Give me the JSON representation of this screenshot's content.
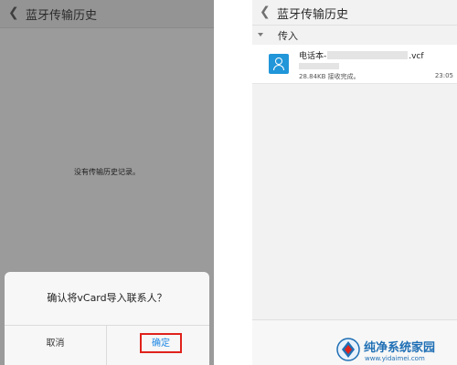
{
  "left_screen": {
    "header": {
      "back_icon": "chevron-left-icon",
      "title": "蓝牙传输历史"
    },
    "empty_message": "没有传输历史记录。",
    "dialog": {
      "message": "确认将vCard导入联系人？",
      "cancel_label": "取消",
      "confirm_label": "确定"
    }
  },
  "right_screen": {
    "header": {
      "back_icon": "chevron-left-icon",
      "title": "蓝牙传输历史"
    },
    "section": {
      "label": "传入"
    },
    "file": {
      "icon": "contact-card-icon",
      "name_prefix": "电话本-",
      "name_suffix": ".vcf",
      "status": "28.84KB 接收完成。",
      "time": "23:05"
    }
  },
  "watermark": {
    "name": "纯净系统家园",
    "url": "www.yidaimei.com"
  },
  "colors": {
    "accent_blue": "#1e88e5",
    "highlight_red": "#e0221b",
    "file_icon_blue": "#2196d9"
  }
}
